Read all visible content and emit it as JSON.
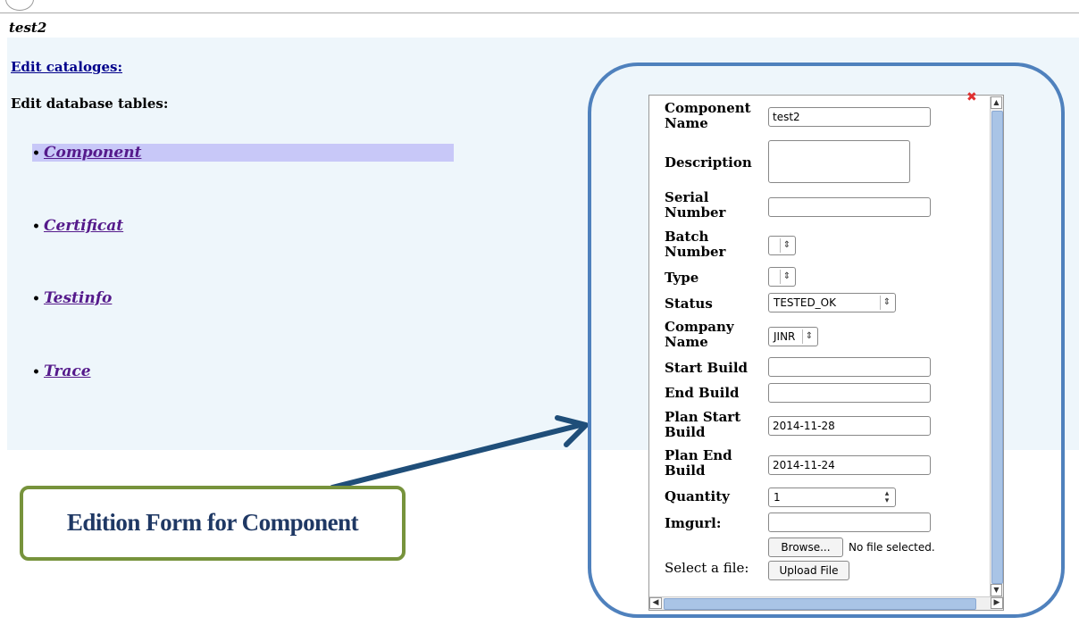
{
  "page": {
    "title": "test2"
  },
  "nav": {
    "edit_catalogs": "Edit cataloges:",
    "edit_tables_heading": "Edit database tables:",
    "tables": [
      {
        "label": "Component"
      },
      {
        "label": "Certificat"
      },
      {
        "label": "Testinfo"
      },
      {
        "label": "Trace"
      }
    ]
  },
  "annotation": {
    "label": "Edition Form for Component"
  },
  "form": {
    "component_name": {
      "label": "Component Name",
      "value": "test2"
    },
    "description": {
      "label": "Description",
      "value": ""
    },
    "serial_number": {
      "label": "Serial Number",
      "value": ""
    },
    "batch_number": {
      "label": "Batch Number",
      "value": ""
    },
    "type": {
      "label": "Type",
      "value": ""
    },
    "status": {
      "label": "Status",
      "value": "TESTED_OK"
    },
    "company_name": {
      "label": "Company Name",
      "value": "JINR"
    },
    "start_build": {
      "label": "Start Build",
      "value": ""
    },
    "end_build": {
      "label": "End Build",
      "value": ""
    },
    "plan_start_build": {
      "label": "Plan Start Build",
      "value": "2014-11-28"
    },
    "plan_end_build": {
      "label": "Plan End Build",
      "value": "2014-11-24"
    },
    "quantity": {
      "label": "Quantity",
      "value": "1"
    },
    "imgurl": {
      "label": "Imgurl:",
      "value": ""
    },
    "browse_label": "Browse...",
    "no_file_text": "No file selected.",
    "select_file_label": "Select a file:",
    "upload_label": "Upload File"
  },
  "colors": {
    "panel_bg": "#eef6fb",
    "highlight": "#c8c8f8",
    "frame": "#4f81bd",
    "callout_border": "#77933c",
    "callout_text": "#1f3864",
    "arrow": "#1f4e79"
  },
  "icons": {
    "close": "close-icon",
    "select_caret": "chevron-updown-icon"
  }
}
